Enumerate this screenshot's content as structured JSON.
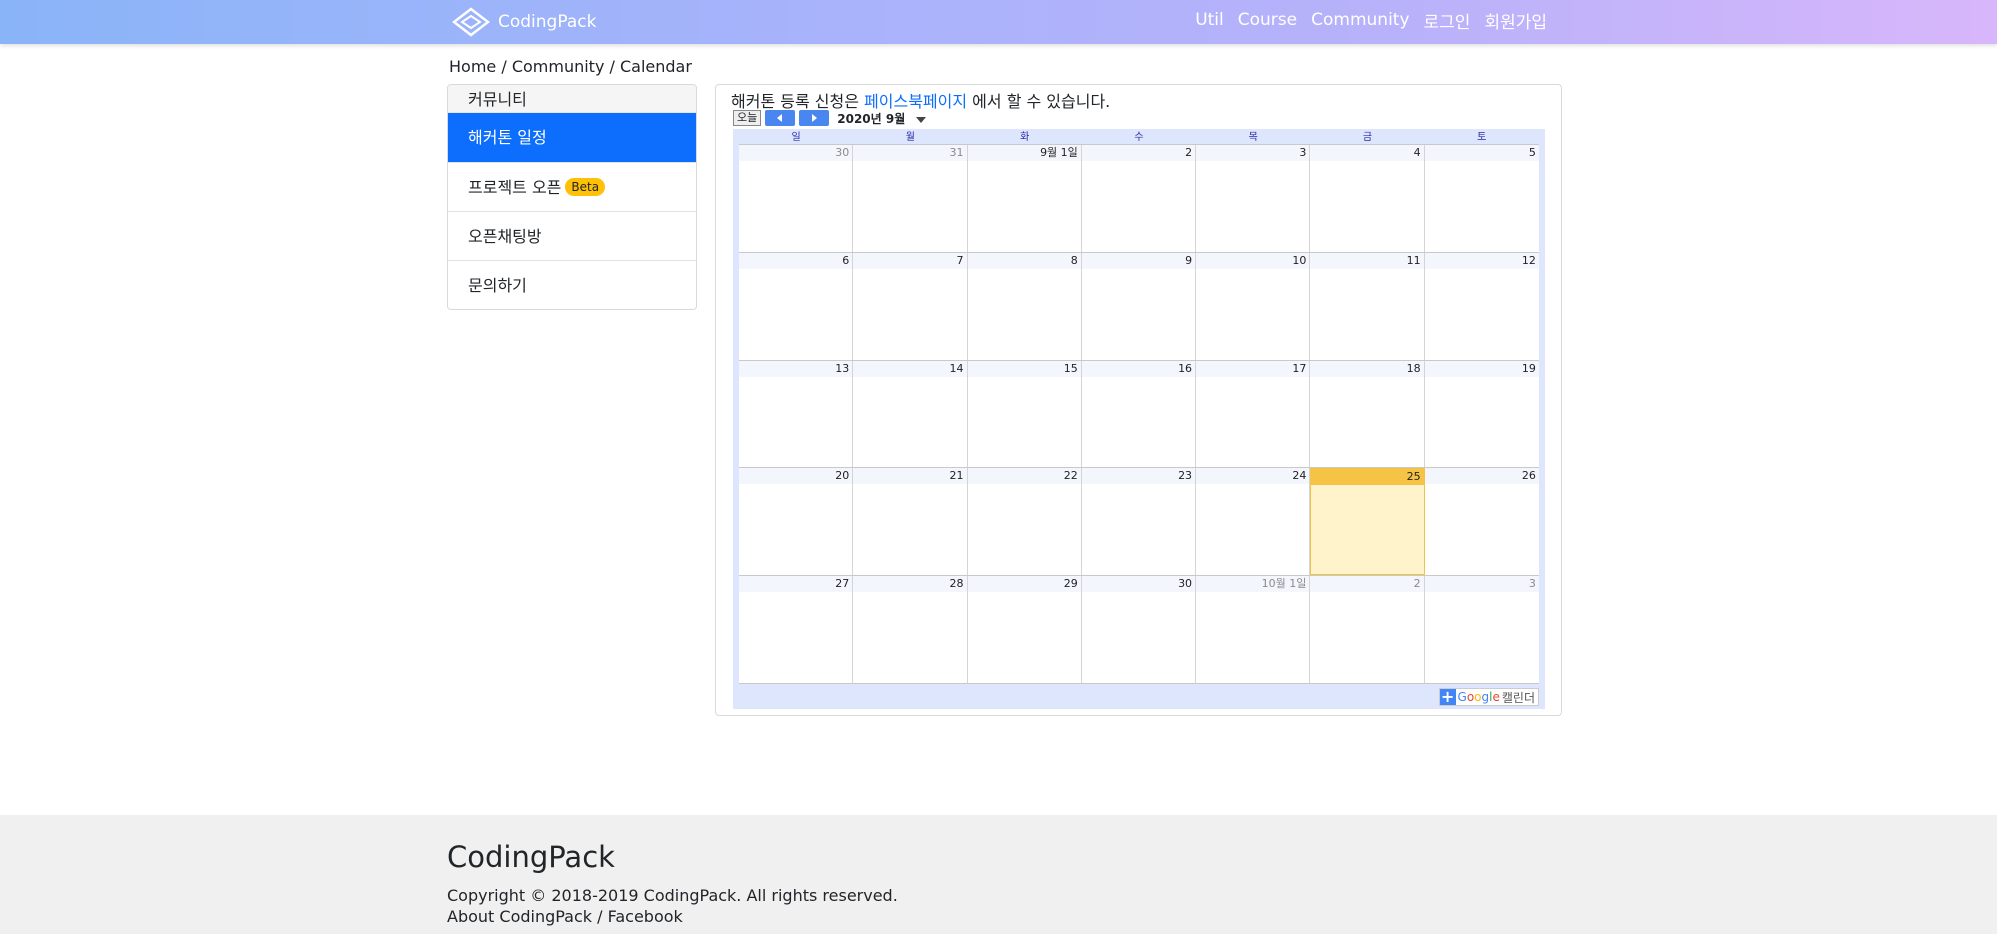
{
  "navbar": {
    "brand": "CodingPack",
    "links": [
      "Util",
      "Course",
      "Community",
      "로그인",
      "회원가입"
    ]
  },
  "breadcrumb": "Home / Community / Calendar",
  "sidebar": {
    "header": "커뮤니티",
    "items": [
      {
        "label": "해커톤 일정",
        "active": true
      },
      {
        "label": "프로젝트 오픈",
        "badge": "Beta"
      },
      {
        "label": "오픈채팅방"
      },
      {
        "label": "문의하기"
      }
    ]
  },
  "main": {
    "notice_prefix": "해커톤 등록 신청은 ",
    "notice_link": "페이스북페이지",
    "notice_suffix": " 에서 할 수 있습니다.",
    "calendar": {
      "today_button": "오늘",
      "month_title": "2020년 9월",
      "weekdays": [
        "일",
        "월",
        "화",
        "수",
        "목",
        "금",
        "토"
      ],
      "weeks": [
        [
          {
            "d": "30",
            "other": true
          },
          {
            "d": "31",
            "other": true
          },
          {
            "d": "9월 1일"
          },
          {
            "d": "2"
          },
          {
            "d": "3"
          },
          {
            "d": "4"
          },
          {
            "d": "5"
          }
        ],
        [
          {
            "d": "6"
          },
          {
            "d": "7"
          },
          {
            "d": "8"
          },
          {
            "d": "9"
          },
          {
            "d": "10"
          },
          {
            "d": "11"
          },
          {
            "d": "12"
          }
        ],
        [
          {
            "d": "13"
          },
          {
            "d": "14"
          },
          {
            "d": "15"
          },
          {
            "d": "16"
          },
          {
            "d": "17"
          },
          {
            "d": "18"
          },
          {
            "d": "19"
          }
        ],
        [
          {
            "d": "20"
          },
          {
            "d": "21"
          },
          {
            "d": "22"
          },
          {
            "d": "23"
          },
          {
            "d": "24"
          },
          {
            "d": "25",
            "today": true
          },
          {
            "d": "26"
          }
        ],
        [
          {
            "d": "27"
          },
          {
            "d": "28"
          },
          {
            "d": "29"
          },
          {
            "d": "30"
          },
          {
            "d": "10월 1일",
            "other": true
          },
          {
            "d": "2",
            "other": true
          },
          {
            "d": "3",
            "other": true
          }
        ]
      ],
      "footer_google": "Google",
      "footer_calendar": "캘린더"
    }
  },
  "footer": {
    "brand": "CodingPack",
    "copyright": "Copyright © 2018-2019 CodingPack. All rights reserved.",
    "about": "About CodingPack",
    "separator": " / ",
    "facebook": "Facebook"
  }
}
